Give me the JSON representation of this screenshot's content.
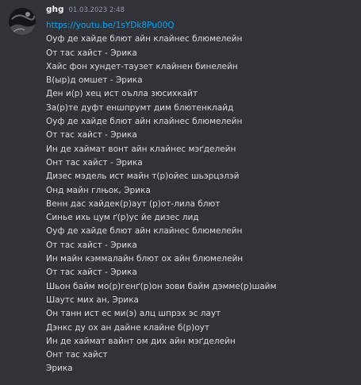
{
  "message": {
    "author": "ghg",
    "timestamp": "01.03.2023 2:48",
    "link": "https://youtu.be/1sYDk8Pu00Q",
    "lines": [
      "Оуф де хайде блют айн клайнес блюмелейн",
      "От тас хайст - Эрика",
      "Хайс фон хундет-таузет клайнен бинелейн",
      "В(ыр)д омшет - Эрика",
      "Ден и(р) хец ист оълла зюсихкайт",
      "За(р)те дуфт еншпрумт дим блютенклайд",
      "Оуф де хайде блют айн клайнес блюмелейн",
      "От тас хайст - Эрика",
      "Ин де хаймат вонт айн клайнес мэґделейн",
      "Онт тас хайст - Эрика",
      "Дизес мэдель ист майн т(р)ойес шьэрцэлэй",
      "Онд майн глњок, Эрика",
      "Венн дас хайдек(р)аут (р)от-лила блют",
      "Синье ихь цум ґ(р)ус йе дизес лид",
      "Оуф де хайде блют айн клайнес блюмелейн",
      "От тас хайст - Эрика",
      "Ин майн кэммалайн блют ох айн блюмелейн",
      "От тас хайст - Эрика",
      "Шьон байм мо(р)генґ(р)он зови байм дэмме(р)шайм",
      "Шаутс мих ан, Эрика",
      "Он танн ист ес ми(э) алц шпрэх эс лаут",
      "Дэнкс ду ох ан дайне клайне б(р)оут",
      "Ин де хаймат вайнт ом дих айн мэґделейн",
      "Онт тас хайст",
      "Эрика"
    ]
  }
}
